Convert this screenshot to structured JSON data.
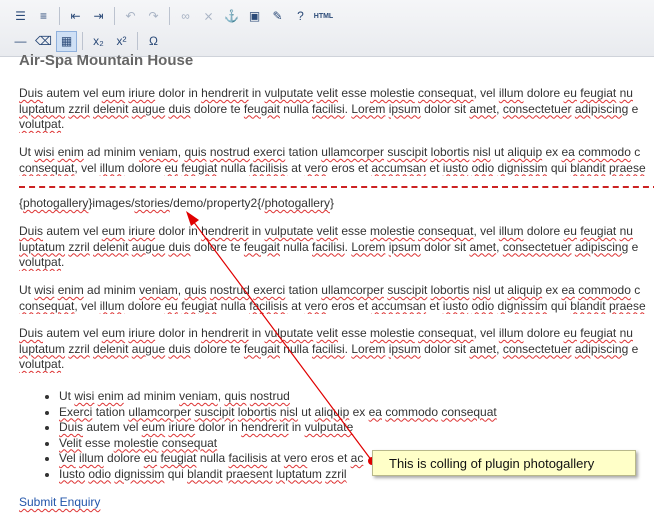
{
  "toolbar": {
    "row1": [
      {
        "name": "bullet-list-icon",
        "glyph": "☰"
      },
      {
        "name": "numbered-list-icon",
        "glyph": "≡"
      },
      {
        "sep": true
      },
      {
        "name": "outdent-icon",
        "glyph": "⇤"
      },
      {
        "name": "indent-icon",
        "glyph": "⇥"
      },
      {
        "sep": true
      },
      {
        "name": "undo-icon",
        "glyph": "↶",
        "dim": true
      },
      {
        "name": "redo-icon",
        "glyph": "↷",
        "dim": true
      },
      {
        "sep": true
      },
      {
        "name": "link-icon",
        "glyph": "∞",
        "dim": true
      },
      {
        "name": "unlink-icon",
        "glyph": "⨯",
        "dim": true
      },
      {
        "name": "anchor-icon",
        "glyph": "⚓"
      },
      {
        "name": "image-icon",
        "glyph": "▣"
      },
      {
        "name": "cleanup-icon",
        "glyph": "✎"
      },
      {
        "name": "help-icon",
        "glyph": "?"
      },
      {
        "name": "html-source-icon",
        "label": "HTML"
      }
    ],
    "row2": [
      {
        "name": "horizontal-rule-icon",
        "glyph": "—"
      },
      {
        "name": "remove-format-icon",
        "glyph": "⌫"
      },
      {
        "name": "visual-aid-icon",
        "glyph": "▦",
        "active": true
      },
      {
        "sep": true
      },
      {
        "name": "subscript-icon",
        "glyph": "x₂"
      },
      {
        "name": "superscript-icon",
        "glyph": "x²"
      },
      {
        "sep": true
      },
      {
        "name": "special-char-icon",
        "glyph": "Ω"
      }
    ]
  },
  "editor": {
    "heading": "Air-Spa Mountain House",
    "para1": {
      "line1": "Duis autem vel eum iriure dolor in hendrerit in vulputate velit esse molestie consequat, vel illum dolore eu feugiat nu",
      "line2": "luptatum zzril delenit augue duis dolore te feugait nulla facilisi. Lorem ipsum dolor sit amet, consectetuer adipiscing e",
      "line3": "volutpat."
    },
    "para2": {
      "line1": "Ut wisi enim ad minim veniam, quis nostrud exerci tation ullamcorper suscipit lobortis nisl ut aliquip ex ea commodo c",
      "line2": "consequat, vel illum dolore eu feugiat nulla facilisis at vero eros et accumsan et iusto odio dignissim qui blandit praese"
    },
    "plugin_code": "{photogallery}images/stories/demo/property2{/photogallery}",
    "para3": {
      "line1": "Duis autem vel eum iriure dolor in hendrerit in vulputate velit esse molestie consequat, vel illum dolore eu feugiat nu",
      "line2": "luptatum zzril delenit augue duis dolore te feugait nulla facilisi. Lorem ipsum dolor sit amet, consectetuer adipiscing e",
      "line3": "volutpat."
    },
    "para4": {
      "line1": "Ut wisi enim ad minim veniam, quis nostrud exerci tation ullamcorper suscipit lobortis nisl ut aliquip ex ea commodo c",
      "line2": "consequat, vel illum dolore eu feugiat nulla facilisis at vero eros et accumsan et iusto odio dignissim qui blandit praese"
    },
    "para5": {
      "line1": "Duis autem vel eum iriure dolor in hendrerit in vulputate velit esse molestie consequat, vel illum dolore eu feugiat nu",
      "line2": "luptatum zzril delenit augue duis dolore te feugait nulla facilisi. Lorem ipsum dolor sit amet, consectetuer adipiscing e",
      "line3": "volutpat."
    },
    "bullets": [
      "Ut wisi enim ad minim veniam, quis nostrud",
      "Exerci tation ullamcorper suscipit lobortis nisl ut aliquip ex ea commodo consequat",
      "Duis autem vel eum iriure dolor in hendrerit in vulputate",
      "Velit esse molestie consequat",
      "Vel illum dolore eu feugiat nulla facilisis at vero eros et ac",
      "Iusto odio dignissim qui blandit praesent luptatum zzril"
    ],
    "submit_link": "Submit Enquiry"
  },
  "annotation": {
    "callout_text": "This is colling of plugin photogallery",
    "arrow_color": "#e00000"
  }
}
